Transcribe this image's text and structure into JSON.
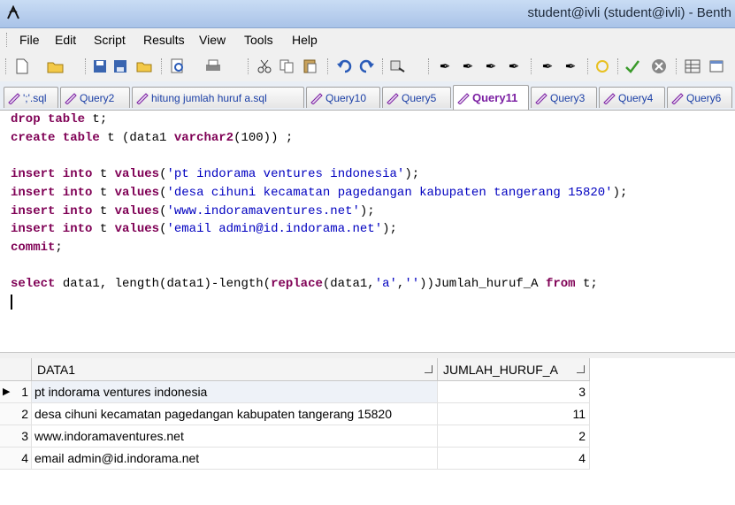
{
  "window": {
    "title": "student@ivli (student@ivli) - Benth"
  },
  "menu": [
    "File",
    "Edit",
    "Script",
    "Results",
    "View",
    "Tools",
    "Help"
  ],
  "toolbar": {
    "icons": [
      "new-document-icon",
      "open-folder-icon",
      "save-icon",
      "save-all-icon",
      "open-icon",
      "print-preview-icon",
      "print-icon",
      "cut-icon",
      "copy-icon",
      "paste-icon",
      "undo-icon",
      "redo-icon",
      "find-icon",
      "execute-icon",
      "execute-script-icon",
      "explain-plan-icon",
      "format-sql-icon",
      "format-icon",
      "format-alt-icon",
      "transaction-icon",
      "commit-icon",
      "rollback-icon",
      "schema-icon",
      "sql-window-icon"
    ]
  },
  "tabs": [
    {
      "label": "';'.sql",
      "active": false
    },
    {
      "label": "Query2",
      "active": false
    },
    {
      "label": "hitung jumlah huruf a.sql",
      "active": false
    },
    {
      "label": "Query10",
      "active": false
    },
    {
      "label": "Query5",
      "active": false
    },
    {
      "label": "Query11",
      "active": true
    },
    {
      "label": "Query3",
      "active": false
    },
    {
      "label": "Query4",
      "active": false
    },
    {
      "label": "Query6",
      "active": false
    }
  ],
  "editor": {
    "lines": [
      [
        {
          "t": "drop table",
          "c": "kw"
        },
        {
          "t": " t;",
          "c": ""
        }
      ],
      [
        {
          "t": "create table",
          "c": "kw"
        },
        {
          "t": " t (data1 ",
          "c": ""
        },
        {
          "t": "varchar2",
          "c": "kw"
        },
        {
          "t": "(100)) ;",
          "c": ""
        }
      ],
      [],
      [
        {
          "t": "insert into",
          "c": "kw"
        },
        {
          "t": " t ",
          "c": ""
        },
        {
          "t": "values",
          "c": "kw"
        },
        {
          "t": "(",
          "c": ""
        },
        {
          "t": "'pt indorama ventures indonesia'",
          "c": "str"
        },
        {
          "t": ");",
          "c": ""
        }
      ],
      [
        {
          "t": "insert into",
          "c": "kw"
        },
        {
          "t": " t ",
          "c": ""
        },
        {
          "t": "values",
          "c": "kw"
        },
        {
          "t": "(",
          "c": ""
        },
        {
          "t": "'desa cihuni kecamatan pagedangan kabupaten tangerang 15820'",
          "c": "str"
        },
        {
          "t": ");",
          "c": ""
        }
      ],
      [
        {
          "t": "insert into",
          "c": "kw"
        },
        {
          "t": " t ",
          "c": ""
        },
        {
          "t": "values",
          "c": "kw"
        },
        {
          "t": "(",
          "c": ""
        },
        {
          "t": "'www.indoramaventures.net'",
          "c": "str"
        },
        {
          "t": ");",
          "c": ""
        }
      ],
      [
        {
          "t": "insert into",
          "c": "kw"
        },
        {
          "t": " t ",
          "c": ""
        },
        {
          "t": "values",
          "c": "kw"
        },
        {
          "t": "(",
          "c": ""
        },
        {
          "t": "'email admin@id.indorama.net'",
          "c": "str"
        },
        {
          "t": ");",
          "c": ""
        }
      ],
      [
        {
          "t": "commit",
          "c": "kw"
        },
        {
          "t": ";",
          "c": ""
        }
      ],
      [],
      [
        {
          "t": "select",
          "c": "kw"
        },
        {
          "t": " data1, length(data1)-length(",
          "c": ""
        },
        {
          "t": "replace",
          "c": "kw"
        },
        {
          "t": "(data1,",
          "c": ""
        },
        {
          "t": "'a'",
          "c": "str"
        },
        {
          "t": ",",
          "c": ""
        },
        {
          "t": "''",
          "c": "str"
        },
        {
          "t": "))Jumlah_huruf_A ",
          "c": ""
        },
        {
          "t": "from",
          "c": "kw"
        },
        {
          "t": " t;",
          "c": ""
        }
      ]
    ]
  },
  "results": {
    "columns": [
      "DATA1",
      "JUMLAH_HURUF_A"
    ],
    "rows": [
      {
        "num": "1",
        "data1": "pt indorama ventures indonesia",
        "count": "3",
        "current": true
      },
      {
        "num": "2",
        "data1": "desa cihuni kecamatan pagedangan kabupaten tangerang 15820",
        "count": "11"
      },
      {
        "num": "3",
        "data1": "www.indoramaventures.net",
        "count": "2"
      },
      {
        "num": "4",
        "data1": "email admin@id.indorama.net",
        "count": "4"
      }
    ]
  }
}
